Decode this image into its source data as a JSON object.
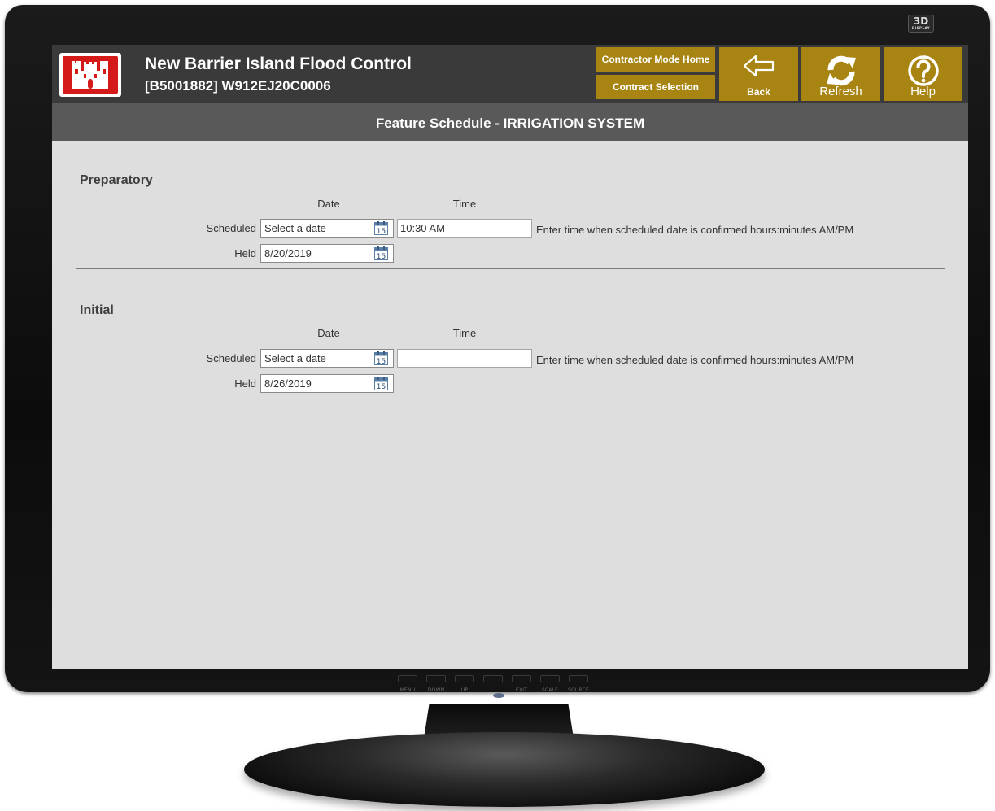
{
  "monitor": {
    "brand_badge": "3D",
    "brand_badge_sub": "DISPLAY",
    "controls": [
      "MENU",
      "DOWN",
      "UP",
      "EXIT",
      "SCALE",
      "SOURCE"
    ]
  },
  "header": {
    "title": "New Barrier Island Flood Control",
    "subtitle": "[B5001882] W912EJ20C0006",
    "buttons": {
      "contractor_home": "Contractor Mode Home",
      "contract_selection": "Contract Selection",
      "back": "Back",
      "refresh": "Refresh",
      "help": "Help"
    }
  },
  "page_title": "Feature Schedule - IRRIGATION SYSTEM",
  "sections": [
    {
      "title": "Preparatory",
      "date_header": "Date",
      "time_header": "Time",
      "scheduled_label": "Scheduled",
      "scheduled_date": "Select a date",
      "scheduled_time": "10:30 AM",
      "hint": "Enter time when scheduled date is confirmed hours:minutes AM/PM",
      "held_label": "Held",
      "held_date": "8/20/2019"
    },
    {
      "title": "Initial",
      "date_header": "Date",
      "time_header": "Time",
      "scheduled_label": "Scheduled",
      "scheduled_date": "Select a date",
      "scheduled_time": "",
      "hint": "Enter time when scheduled date is confirmed hours:minutes AM/PM",
      "held_label": "Held",
      "held_date": "8/26/2019"
    }
  ],
  "calendar_icon_text": "15",
  "colors": {
    "header_bg": "#3a3a3a",
    "title_bar_bg": "#595959",
    "button_gold": "#a88512",
    "logo_red": "#d51a1a",
    "content_bg": "#dedede"
  }
}
